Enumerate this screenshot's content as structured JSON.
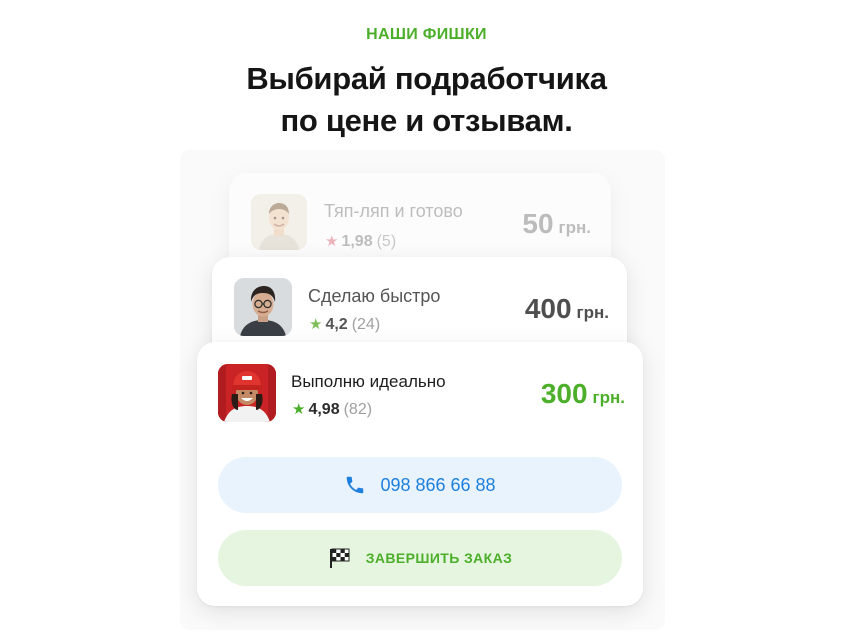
{
  "header": {
    "eyebrow": "НАШИ ФИШКИ",
    "headline_line1": "Выбирай подработчика",
    "headline_line2": "по цене и отзывам."
  },
  "offers": [
    {
      "title": "Тяп-ляп и готово",
      "rating": "1,98",
      "reviews": "(5)",
      "price": "50",
      "currency": "грн.",
      "star_color": "#e07a86"
    },
    {
      "title": "Сделаю быстро",
      "rating": "4,2",
      "reviews": "(24)",
      "price": "400",
      "currency": "грн.",
      "star_color": "#7dbe5a"
    },
    {
      "title": "Выполню идеально",
      "rating": "4,98",
      "reviews": "(82)",
      "price": "300",
      "currency": "грн.",
      "star_color": "#4caf2a"
    }
  ],
  "actions": {
    "phone": "098 866 66 88",
    "phone_icon": "phone-icon",
    "finish": "ЗАВЕРШИТЬ ЗАКАЗ",
    "finish_icon": "checkered-flag-icon"
  },
  "colors": {
    "accent_green": "#4caf2a",
    "phone_blue": "#1e7fdc",
    "heading": "#151515"
  }
}
